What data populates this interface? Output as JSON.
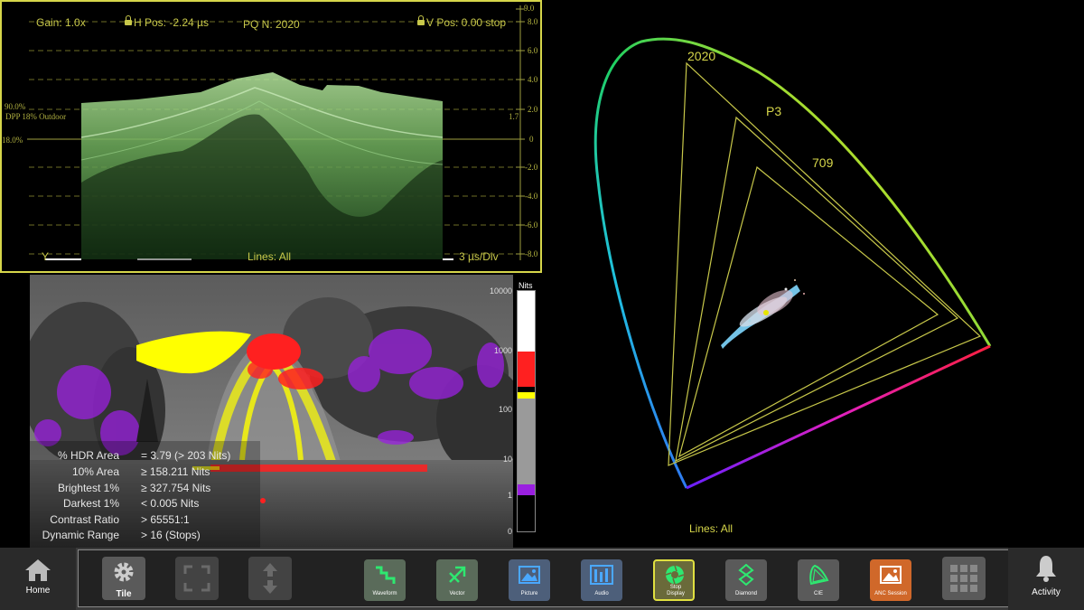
{
  "waveform": {
    "gain": "Gain: 1.0x",
    "h_pos": "H Pos: -2.24 µs",
    "pq": "PQ N: 2020",
    "v_pos": "V Pos: 0.00 stop",
    "y_label": "Y",
    "lines": "Lines: All",
    "time_div": "3 µs/Div",
    "pct90": "90.0%",
    "pct18": "18.0%",
    "dpp_label": "DPP 18% Outdoor",
    "dpp_value": "1.7",
    "scale": [
      "9.0",
      "8.0",
      "6.0",
      "4.0",
      "2.0",
      "0",
      "-2.0",
      "-4.0",
      "-6.0",
      "-8.0"
    ]
  },
  "stats": [
    {
      "label": "% HDR Area",
      "value": "= 3.79 (> 203 Nits)"
    },
    {
      "label": "10% Area",
      "value": "≥ 158.211 Nits"
    },
    {
      "label": "Brightest 1%",
      "value": "≥ 327.754 Nits"
    },
    {
      "label": "Darkest 1%",
      "value": "< 0.005 Nits"
    },
    {
      "label": "Contrast Ratio",
      "value": "> 65551:1"
    },
    {
      "label": "Dynamic Range",
      "value": "> 16 (Stops)"
    }
  ],
  "nits": {
    "title": "Nits",
    "ticks": [
      "10000",
      "1000",
      "100",
      "10",
      "1",
      "0"
    ]
  },
  "cie": {
    "label_2020": "2020",
    "label_p3": "P3",
    "label_709": "709",
    "lines": "Lines: All"
  },
  "toolbar": {
    "home": "Home",
    "tile": "Tile",
    "waveform": "Waveform",
    "vector": "Vector",
    "picture": "Picture",
    "audio": "Audio",
    "stop_display_1": "Stop",
    "stop_display_2": "Display",
    "diamond": "Diamond",
    "cie": "CIE",
    "anc_session": "ANC Session",
    "activity": "Activity"
  },
  "colors": {
    "accent": "#d6d64a",
    "hdr_red": "#ff2020",
    "hdr_yellow": "#ffff00",
    "dark_purple": "#9a20e0",
    "waveform_green": "#6fae5c"
  }
}
